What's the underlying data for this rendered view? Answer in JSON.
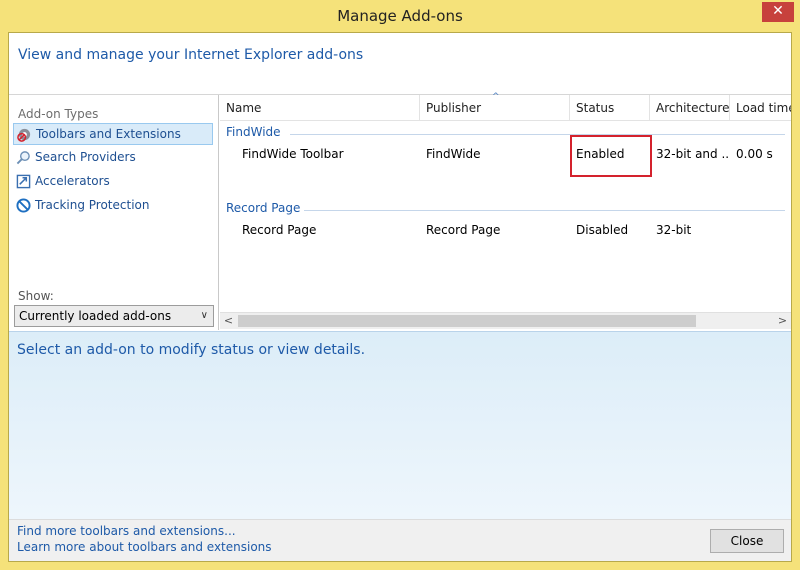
{
  "window": {
    "title": "Manage Add-ons",
    "close_glyph": "✕"
  },
  "header": {
    "text": "View and manage your Internet Explorer add-ons"
  },
  "sidebar": {
    "addon_types_label": "Add-on Types",
    "items": [
      {
        "label": "Toolbars and Extensions",
        "icon": "gear-icon",
        "selected": true
      },
      {
        "label": "Search Providers",
        "icon": "search-icon",
        "selected": false
      },
      {
        "label": "Accelerators",
        "icon": "accelerator-icon",
        "selected": false
      },
      {
        "label": "Tracking Protection",
        "icon": "tracking-protection-icon",
        "selected": false
      }
    ],
    "show_label": "Show:",
    "show_selected": "Currently loaded add-ons",
    "show_arrow": "∨"
  },
  "list": {
    "columns": [
      "Name",
      "Publisher",
      "Status",
      "Architecture",
      "Load time"
    ],
    "sort_caret": "^",
    "groups": [
      {
        "name": "FindWide",
        "rows": [
          {
            "name": "FindWide Toolbar",
            "publisher": "FindWide",
            "status": "Enabled",
            "architecture": "32-bit and ...",
            "load_time": "0.00 s"
          }
        ]
      },
      {
        "name": "Record Page",
        "rows": [
          {
            "name": "Record Page",
            "publisher": "Record Page",
            "status": "Disabled",
            "architecture": "32-bit",
            "load_time": ""
          }
        ]
      }
    ],
    "scroll_left": "<",
    "scroll_right": ">"
  },
  "details": {
    "text": "Select an add-on to modify status or view details."
  },
  "footer": {
    "link1": "Find more toolbars and extensions...",
    "link2": "Learn more about toolbars and extensions",
    "close_label": "Close"
  },
  "colors": {
    "title_bar": "#f5e27a",
    "accent_text": "#1e5aa8",
    "highlight_box": "#d4222d",
    "close_x": "#c7413c"
  }
}
